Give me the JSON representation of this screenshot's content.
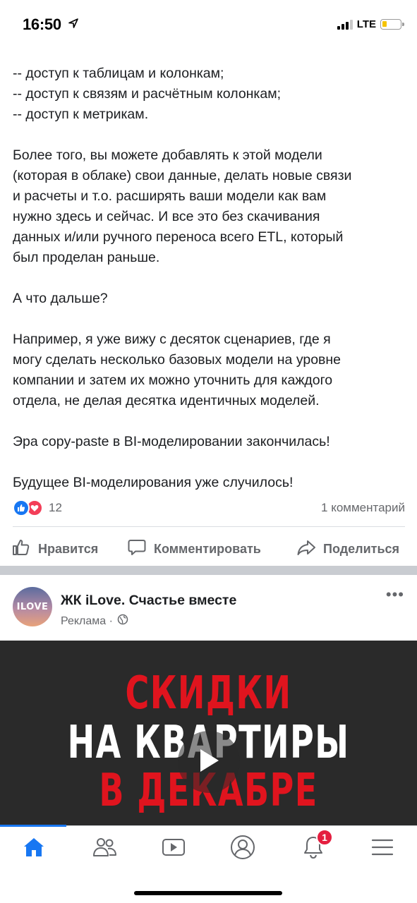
{
  "status_bar": {
    "time": "16:50",
    "network": "LTE",
    "icons": [
      "location-arrow-icon",
      "signal-icon",
      "battery-icon"
    ]
  },
  "post": {
    "paragraphs": [
      "-- доступ к таблицам и колонкам;\n-- доступ к связям и расчётным колонкам;\n-- доступ к метрикам.",
      "Более того, вы можете добавлять к этой модели\n(которая в облаке) свои данные, делать новые связи\nи расчеты и т.о. расширять ваши модели как вам\nнужно здесь и сейчас. И все это без скачивания\nданных и/или ручного переноса всего ETL, который\nбыл проделан раньше.",
      "А что дальше?",
      "Например, я уже вижу с десяток сценариев, где я\nмогу сделать несколько базовых модели на уровне\nкомпании и затем их можно уточнить для каждого\nотдела, не делая десятка идентичных моделей.",
      "Эра copy-paste в BI-моделировании закончилась!",
      "Будущее BI-моделирования уже случилось!"
    ],
    "reactions": {
      "count": "12",
      "comments": "1 комментарий",
      "icons": [
        "like-icon",
        "love-icon"
      ]
    },
    "actions": {
      "like": "Нравится",
      "comment": "Комментировать",
      "share": "Поделиться"
    }
  },
  "ad": {
    "avatar_text": "ILOVE",
    "title": "ЖК iLove. Счастье вместе",
    "sponsored": "Реклама ·",
    "media_lines": [
      "СКИДКИ",
      "НА КВАРТИРЫ",
      "В ДЕКАБРЕ"
    ],
    "colors": {
      "accent_red": "#e0141e",
      "media_bg": "#2a2a2a"
    }
  },
  "tab_bar": {
    "tabs": [
      "home-icon",
      "friends-icon",
      "watch-icon",
      "profile-icon",
      "notifications-icon",
      "menu-icon"
    ],
    "notification_badge": "1",
    "active_color": "#1877f2"
  }
}
